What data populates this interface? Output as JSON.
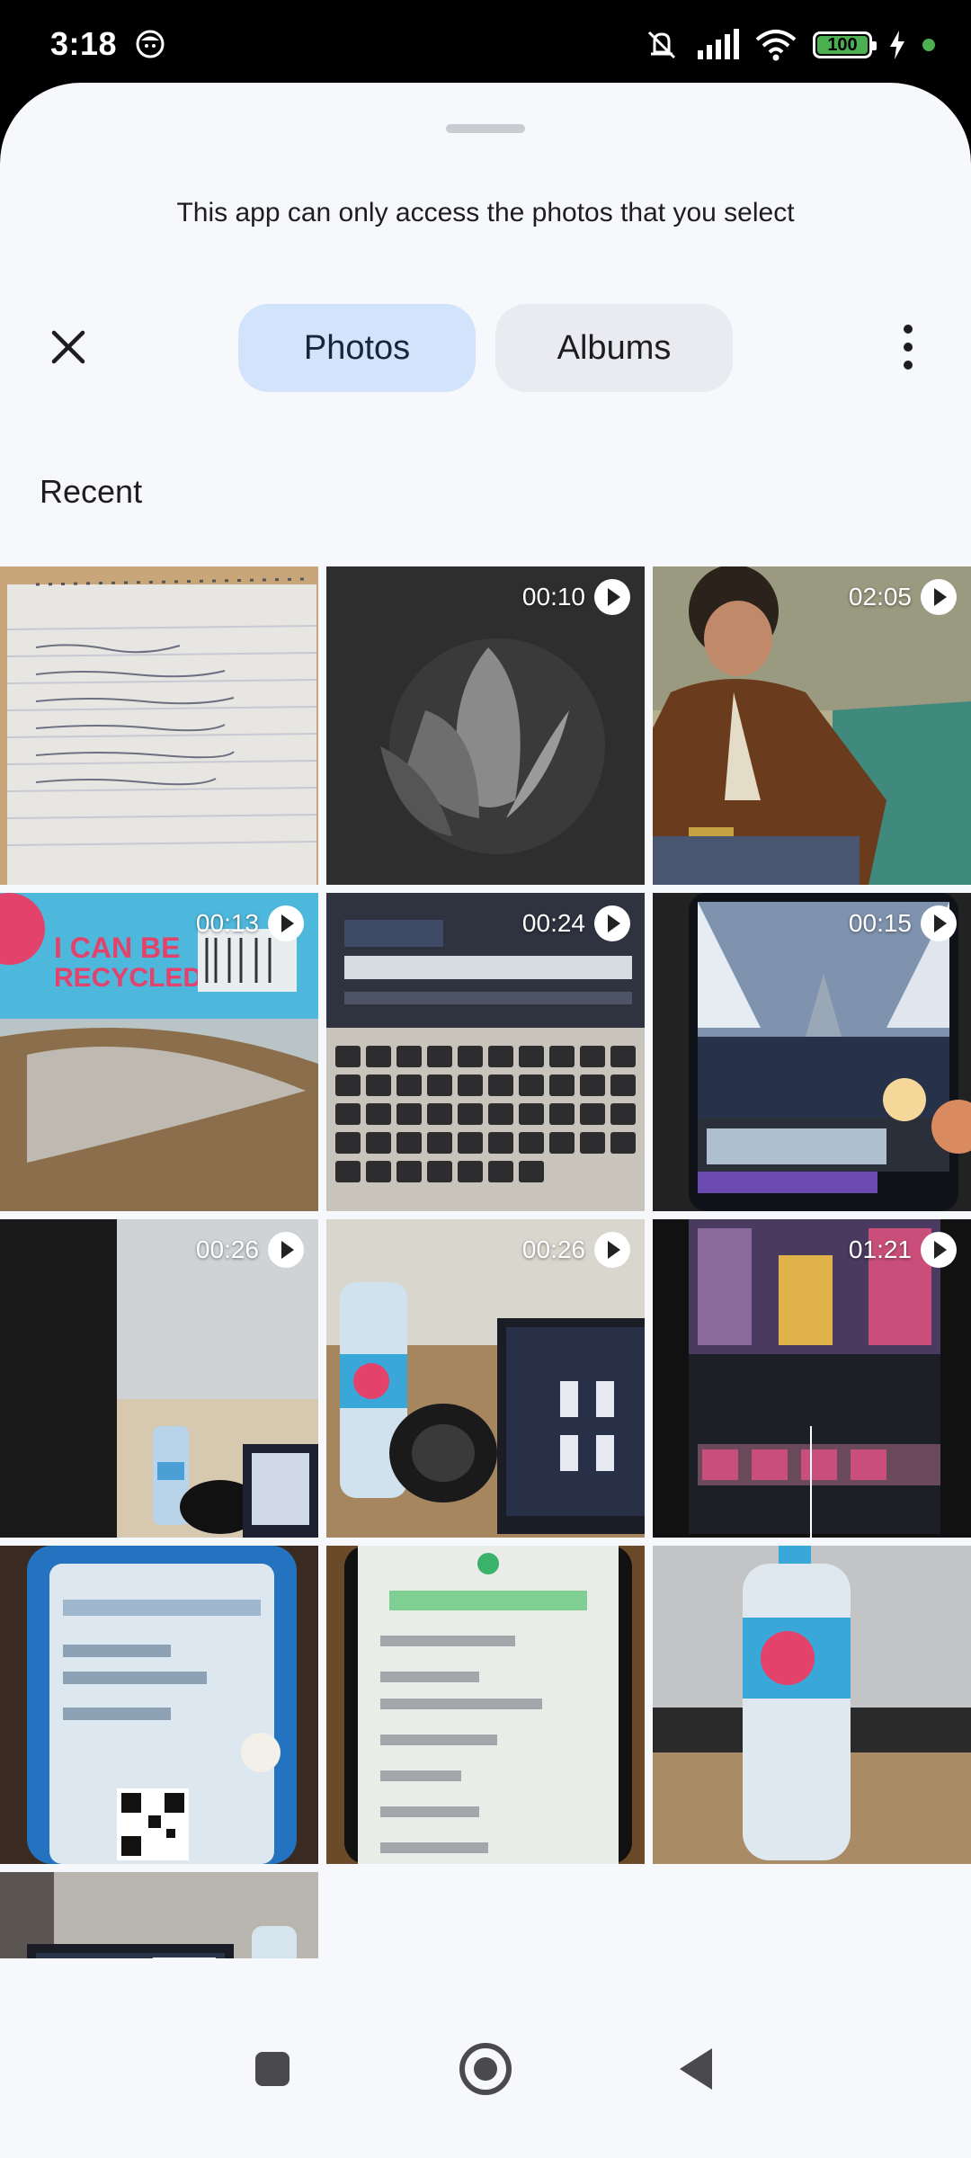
{
  "status_bar": {
    "time": "3:18",
    "battery": "100",
    "icons": [
      "face-app-icon",
      "mute-icon",
      "signal-icon",
      "wifi-icon",
      "battery-icon",
      "charging-icon"
    ]
  },
  "sheet": {
    "notice": "This app can only access the photos that you select",
    "tabs": [
      {
        "label": "Photos",
        "active": true
      },
      {
        "label": "Albums",
        "active": false
      }
    ],
    "section_title": "Recent"
  },
  "media": [
    {
      "type": "photo",
      "duration": "",
      "subject": "notebook"
    },
    {
      "type": "video",
      "duration": "00:10",
      "subject": "flower"
    },
    {
      "type": "video",
      "duration": "02:05",
      "subject": "man-jacket"
    },
    {
      "type": "video",
      "duration": "00:13",
      "subject": "bottle-label"
    },
    {
      "type": "video",
      "duration": "00:24",
      "subject": "laptop-keyboard"
    },
    {
      "type": "video",
      "duration": "00:15",
      "subject": "phone-editor"
    },
    {
      "type": "video",
      "duration": "00:26",
      "subject": "office-desk"
    },
    {
      "type": "video",
      "duration": "00:26",
      "subject": "bottle-laptop"
    },
    {
      "type": "video",
      "duration": "01:21",
      "subject": "times-square-editor"
    },
    {
      "type": "photo",
      "duration": "",
      "subject": "phone-qr"
    },
    {
      "type": "photo",
      "duration": "",
      "subject": "transaction-screen"
    },
    {
      "type": "photo",
      "duration": "",
      "subject": "bottle-table"
    },
    {
      "type": "photo",
      "duration": "",
      "subject": "laptop-office"
    }
  ],
  "colors": {
    "sheet_bg": "#f7f8fc",
    "active_tab_bg": "#d2e4fb",
    "inactive_tab_bg": "#eaebf0"
  }
}
